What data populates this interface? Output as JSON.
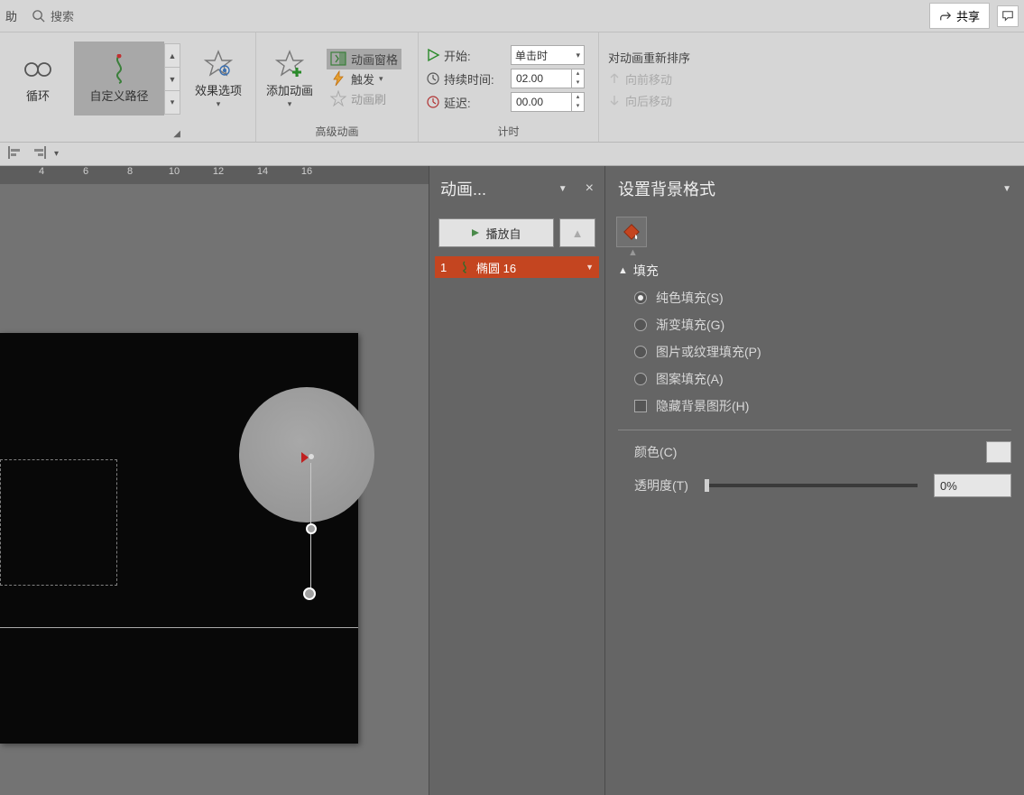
{
  "topbar": {
    "help_frag": "助",
    "search": "搜索",
    "share": "共享"
  },
  "ribbon": {
    "effects_gallery": {
      "loop": "循环",
      "custom_path": "自定义路径"
    },
    "effect_options": "效果选项",
    "advanced": {
      "add": "添加动画",
      "pane": "动画窗格",
      "trigger": "触发",
      "painter": "动画刷",
      "group_label": "高级动画"
    },
    "timing": {
      "start_label": "开始:",
      "start_value": "单击时",
      "duration_label": "持续时间:",
      "duration_value": "02.00",
      "delay_label": "延迟:",
      "delay_value": "00.00",
      "group_label": "计时"
    },
    "reorder": {
      "title": "对动画重新排序",
      "forward": "向前移动",
      "backward": "向后移动"
    }
  },
  "ruler_labels": [
    "4",
    "6",
    "8",
    "10",
    "12",
    "14",
    "16"
  ],
  "anim_pane": {
    "title": "动画...",
    "play_from": "播放自",
    "item": {
      "index": "1",
      "name": "椭圆 16"
    }
  },
  "format_pane": {
    "title": "设置背景格式",
    "fill_section": "填充",
    "solid": "纯色填充(S)",
    "gradient": "渐变填充(G)",
    "picture": "图片或纹理填充(P)",
    "pattern": "图案填充(A)",
    "hide_bg": "隐藏背景图形(H)",
    "color_label": "颜色(C)",
    "transparency_label": "透明度(T)",
    "transparency_value": "0%"
  }
}
